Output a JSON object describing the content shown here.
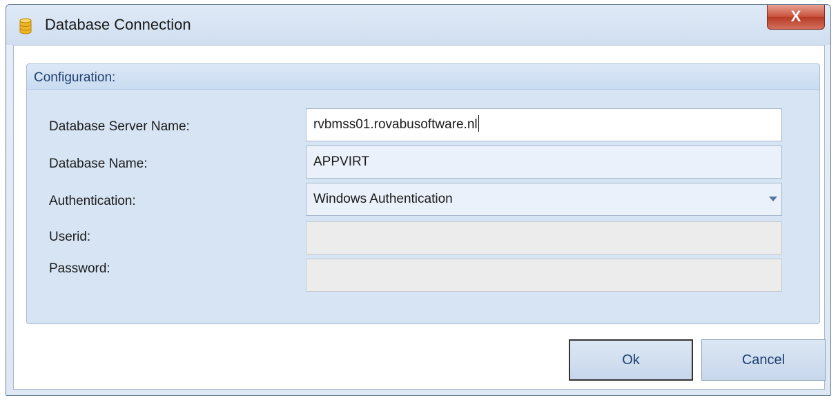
{
  "window": {
    "title": "Database Connection",
    "close_label": "X"
  },
  "group": {
    "title": "Configuration:"
  },
  "fields": {
    "server": {
      "label": "Database Server Name:",
      "value": "rvbmss01.rovabusoftware.nl"
    },
    "database": {
      "label": "Database Name:",
      "value": "APPVIRT"
    },
    "authentication": {
      "label": "Authentication:",
      "value": "Windows Authentication"
    },
    "userid": {
      "label": "Userid:",
      "value": ""
    },
    "password": {
      "label": "Password:",
      "value": ""
    }
  },
  "buttons": {
    "ok": "Ok",
    "cancel": "Cancel"
  },
  "icons": {
    "app": "database-icon",
    "close": "close-icon",
    "dropdown": "chevron-down-icon"
  },
  "colors": {
    "title_bar": "#d0def0",
    "group_background": "#d6e4f4",
    "group_title": "#1e3f70",
    "close_button": "#c8513c"
  }
}
